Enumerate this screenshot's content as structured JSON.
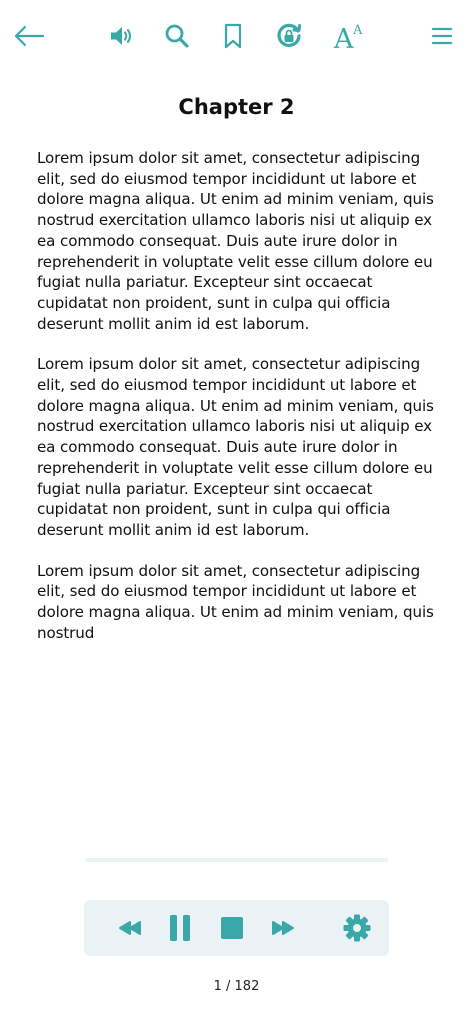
{
  "colors": {
    "accent": "#3aa8a8",
    "text": "#111111",
    "player_bg": "#eaf2f5",
    "track": "#eef3f6"
  },
  "toolbar": {
    "icons": [
      "back-arrow-icon",
      "speaker-icon",
      "search-icon",
      "bookmark-icon",
      "sync-lock-icon",
      "font-size-icon",
      "menu-icon"
    ],
    "font_glyph_large": "A",
    "font_glyph_small": "A"
  },
  "chapter": {
    "title": "Chapter 2",
    "paragraphs": [
      "Lorem ipsum dolor sit amet, consectetur adipiscing elit, sed do eiusmod tempor incididunt ut labore et dolore magna aliqua. Ut enim ad minim veniam, quis nostrud exercitation ullamco laboris nisi ut aliquip ex ea commodo consequat. Duis aute irure dolor in reprehenderit in voluptate velit esse cillum dolore eu fugiat nulla pariatur. Excepteur sint occaecat cupidatat non proident, sunt in culpa qui officia deserunt mollit anim id est laborum.",
      "Lorem ipsum dolor sit amet, consectetur adipiscing elit, sed do eiusmod tempor incididunt ut labore et dolore magna aliqua. Ut enim ad minim veniam, quis nostrud exercitation ullamco laboris nisi ut aliquip ex ea commodo consequat. Duis aute irure dolor in reprehenderit in voluptate velit esse cillum dolore eu fugiat nulla pariatur. Excepteur sint occaecat cupidatat non proident, sunt in culpa qui officia deserunt mollit anim id est laborum.",
      "Lorem ipsum dolor sit amet, consectetur adipiscing elit, sed do eiusmod tempor incididunt ut labore et dolore magna aliqua. Ut enim ad minim veniam, quis nostrud"
    ]
  },
  "player": {
    "icons": [
      "rewind-icon",
      "pause-icon",
      "stop-icon",
      "fast-forward-icon",
      "settings-gear-icon"
    ]
  },
  "pagination": {
    "label": "1 / 182"
  }
}
